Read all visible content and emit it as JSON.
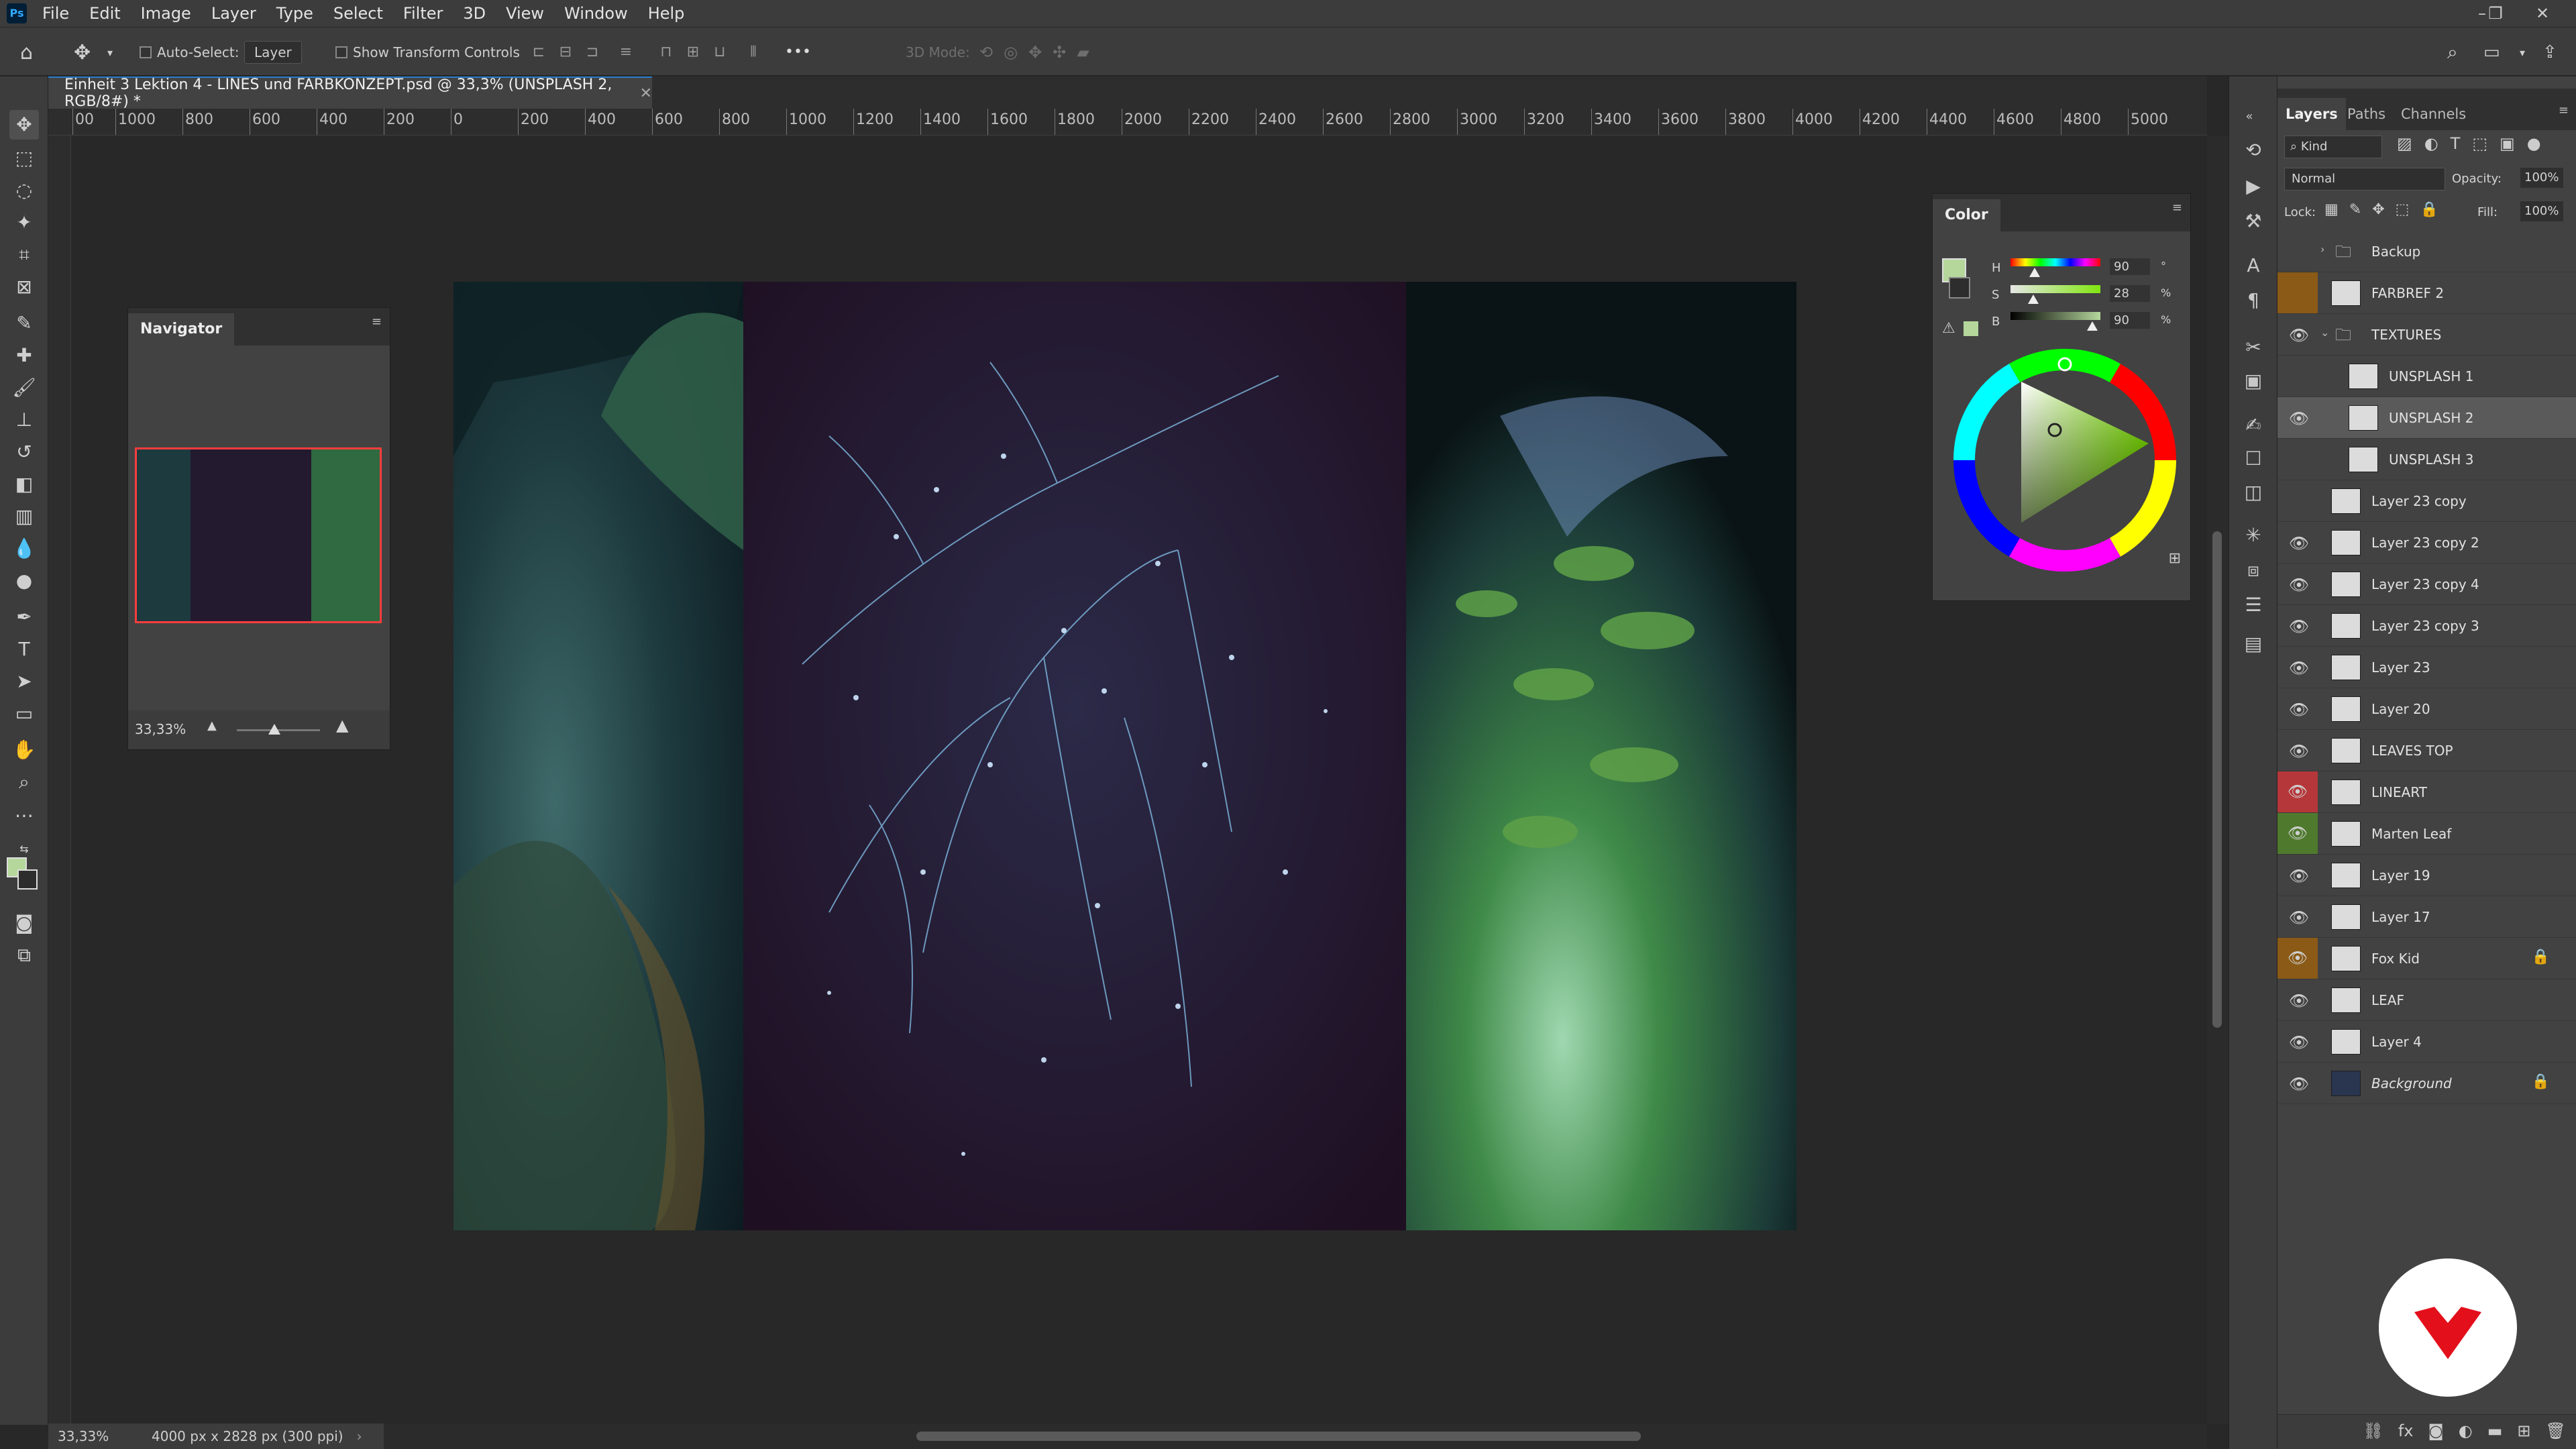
{
  "menubar": {
    "logo_text": "Ps",
    "items": [
      "File",
      "Edit",
      "Image",
      "Layer",
      "Type",
      "Select",
      "Filter",
      "3D",
      "View",
      "Window",
      "Help"
    ]
  },
  "options": {
    "auto_select_label": "Auto-Select:",
    "auto_select_value": "Layer",
    "show_transform_label": "Show Transform Controls",
    "mode_3d_label": "3D Mode:"
  },
  "document": {
    "tab_title": "Einheit 3 Lektion 4 - LINES und FARBKONZEPT.psd @ 33,3% (UNSPLASH 2, RGB/8#) *",
    "ruler_labels": [
      "00",
      "1000",
      "800",
      "600",
      "400",
      "200",
      "0",
      "200",
      "400",
      "600",
      "800",
      "1000",
      "1200",
      "1400",
      "1600",
      "1800",
      "2000",
      "2200",
      "2400",
      "2600",
      "2800",
      "3000",
      "3200",
      "3400",
      "3600",
      "3800",
      "4000",
      "4200",
      "4400",
      "4600",
      "4800",
      "5000"
    ]
  },
  "navigator": {
    "title": "Navigator",
    "zoom": "33,33%",
    "zoom_slider_fraction": 0.45
  },
  "color": {
    "title": "Color",
    "h_label": "H",
    "h_value": "90",
    "h_unit": "°",
    "s_label": "S",
    "s_value": "28",
    "s_unit": "%",
    "b_label": "B",
    "b_value": "90",
    "b_unit": "%",
    "foreground": "#b5d79c",
    "background": "#2d2d2d"
  },
  "status": {
    "zoom": "33,33%",
    "doc_info": "4000 px x 2828 px (300 ppi)"
  },
  "layers_panel": {
    "tabs": [
      "Layers",
      "Paths",
      "Channels"
    ],
    "filter_kind": "Kind",
    "blend_mode": "Normal",
    "opacity_label": "Opacity:",
    "opacity_value": "100%",
    "lock_label": "Lock:",
    "fill_label": "Fill:",
    "fill_value": "100%",
    "layers": [
      {
        "name": "Backup",
        "visible": false,
        "type": "group",
        "color": ""
      },
      {
        "name": "FARBREF 2",
        "visible": false,
        "type": "layer",
        "color": "#8a5a16"
      },
      {
        "name": "TEXTURES",
        "visible": true,
        "type": "group-open",
        "color": ""
      },
      {
        "name": "UNSPLASH 1",
        "visible": false,
        "type": "child",
        "color": ""
      },
      {
        "name": "UNSPLASH 2",
        "visible": true,
        "type": "child",
        "color": "",
        "selected": true
      },
      {
        "name": "UNSPLASH 3",
        "visible": false,
        "type": "child",
        "color": ""
      },
      {
        "name": "Layer 23 copy",
        "visible": false,
        "type": "layer",
        "color": ""
      },
      {
        "name": "Layer 23 copy 2",
        "visible": true,
        "type": "layer",
        "color": ""
      },
      {
        "name": "Layer 23 copy 4",
        "visible": true,
        "type": "layer",
        "color": ""
      },
      {
        "name": "Layer 23 copy 3",
        "visible": true,
        "type": "layer",
        "color": ""
      },
      {
        "name": "Layer 23",
        "visible": true,
        "type": "layer",
        "color": ""
      },
      {
        "name": "Layer 20",
        "visible": true,
        "type": "layer",
        "color": ""
      },
      {
        "name": "LEAVES TOP",
        "visible": true,
        "type": "layer",
        "color": ""
      },
      {
        "name": "LINEART",
        "visible": true,
        "type": "layer",
        "color": "#b5373a"
      },
      {
        "name": "Marten Leaf",
        "visible": true,
        "type": "layer",
        "color": "#4f7a2e"
      },
      {
        "name": "Layer 19",
        "visible": true,
        "type": "layer",
        "color": ""
      },
      {
        "name": "Layer 17",
        "visible": true,
        "type": "layer",
        "color": ""
      },
      {
        "name": "Fox Kid",
        "visible": true,
        "type": "layer",
        "color": "#8a5a16",
        "locked": true
      },
      {
        "name": "LEAF",
        "visible": true,
        "type": "layer",
        "color": ""
      },
      {
        "name": "Layer 4",
        "visible": true,
        "type": "layer",
        "color": ""
      },
      {
        "name": "Background",
        "visible": true,
        "type": "layer",
        "color": "",
        "locked": true,
        "italic": true
      }
    ]
  },
  "colors": {
    "accent": "#2a7fd0",
    "nav_frame": "#ff3d3d",
    "brand_logo": "#e3101c"
  }
}
